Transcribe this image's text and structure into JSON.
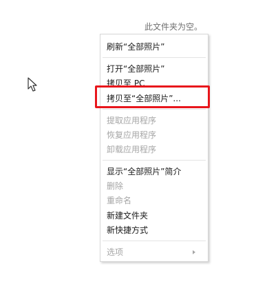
{
  "folder": {
    "empty_message": "此文件夹为空。"
  },
  "context_menu": {
    "refresh": "刷新“全部照片”",
    "open": "打开“全部照片”",
    "copy_to_pc": "拷贝至 PC",
    "copy_to": "拷贝至“全部照片”...",
    "extract_app": "提取应用程序",
    "restore_app": "恢复应用程序",
    "uninstall_app": "卸载应用程序",
    "show_info": "显示“全部照片”简介",
    "delete": "删除",
    "rename": "重命名",
    "new_folder": "新建文件夹",
    "new_shortcut": "新快捷方式",
    "options": "选项"
  },
  "colors": {
    "highlight_border": "#e8151b",
    "disabled_text": "#a6a6a6",
    "enabled_text": "#1a1a1a"
  },
  "icons": {
    "cursor": "mouse-pointer-icon",
    "submenu": "chevron-right-icon"
  }
}
